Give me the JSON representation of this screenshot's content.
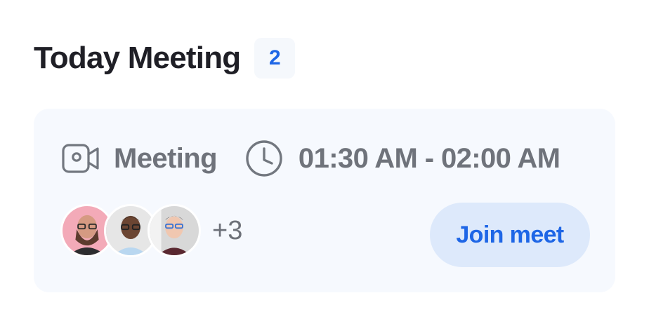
{
  "header": {
    "title": "Today Meeting",
    "count": "2"
  },
  "meeting": {
    "type_label": "Meeting",
    "time_range": "01:30 AM - 02:00 AM",
    "participants": {
      "extra_count": "+3"
    },
    "join_label": "Join meet"
  },
  "colors": {
    "accent": "#1E66E6",
    "card_background": "#F6F9FE",
    "badge_background": "#F5F8FC",
    "button_background": "#DDE9FB",
    "title_text": "#1F1F26",
    "muted_text": "#6F737B"
  },
  "icons": {
    "meeting": "video-camera-icon",
    "time": "clock-icon"
  }
}
